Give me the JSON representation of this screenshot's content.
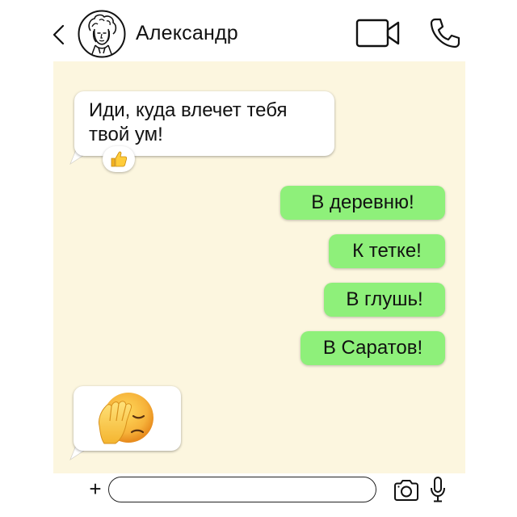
{
  "header": {
    "contact_name": "Александр",
    "icons": {
      "back": "chevron-left-icon",
      "avatar": "avatar-portrait",
      "video": "video-camera-icon",
      "call": "phone-icon"
    }
  },
  "chat": {
    "background": "#fcf6df",
    "incoming_bubble_color": "#ffffff",
    "outgoing_bubble_color": "#8ef07a",
    "messages": [
      {
        "direction": "incoming",
        "lines": [
          "Иди, куда влечет тебя",
          "твой ум!"
        ],
        "reaction": "thumbs-up-emoji"
      },
      {
        "direction": "outgoing",
        "text": "В деревню!"
      },
      {
        "direction": "outgoing",
        "text": "К тетке!"
      },
      {
        "direction": "outgoing",
        "text": "В глушь!"
      },
      {
        "direction": "outgoing",
        "text": "В Саратов!"
      },
      {
        "direction": "incoming",
        "emoji": "facepalm-emoji"
      }
    ]
  },
  "input_bar": {
    "plus_label": "+",
    "placeholder": "",
    "icons": {
      "plus": "plus-icon",
      "camera": "camera-icon",
      "mic": "microphone-icon"
    }
  }
}
